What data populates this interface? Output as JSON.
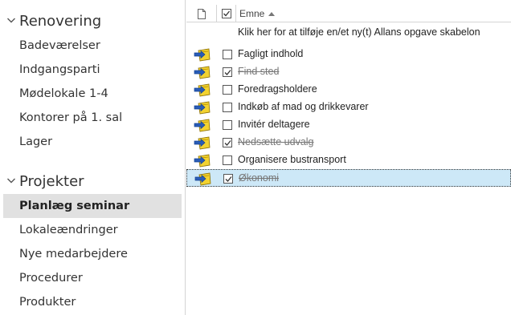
{
  "sidebar": {
    "groups": [
      {
        "title": "Renovering",
        "items": [
          "Badeværelser",
          "Indgangsparti",
          "Mødelokale 1-4",
          "Kontorer på 1. sal",
          "Lager"
        ]
      },
      {
        "title": "Projekter",
        "items": [
          "Planlæg seminar",
          "Lokaleændringer",
          "Nye medarbejdere",
          "Procedurer",
          "Produkter"
        ]
      }
    ],
    "selected_item": "Planlæg seminar"
  },
  "columns": {
    "subject_label": "Emne",
    "sort": "ascending"
  },
  "new_task_prompt": "Klik her for at tilføje en/et ny(t) Allans opgave skabelon",
  "tasks": [
    {
      "subject": "Fagligt indhold",
      "completed": false
    },
    {
      "subject": "Find sted",
      "completed": true
    },
    {
      "subject": "Foredragsholdere",
      "completed": false
    },
    {
      "subject": "Indkøb af mad og drikkevarer",
      "completed": false
    },
    {
      "subject": "Invitér deltagere",
      "completed": false
    },
    {
      "subject": "Nedsætte udvalg",
      "completed": true
    },
    {
      "subject": "Organisere bustransport",
      "completed": false
    },
    {
      "subject": "Økonomi",
      "completed": true
    }
  ],
  "selected_task": "Økonomi",
  "colors": {
    "selected_nav_bg": "#e1e1e1",
    "selected_row_bg": "#cde8f7",
    "task_icon_yellow": "#f2d230",
    "task_icon_blue": "#2a5db8"
  },
  "icons": {
    "group_toggle": "chevron-down-icon",
    "column_icon": "document-icon",
    "column_complete": "checkbox-icon",
    "task": "task-assigned-icon"
  }
}
